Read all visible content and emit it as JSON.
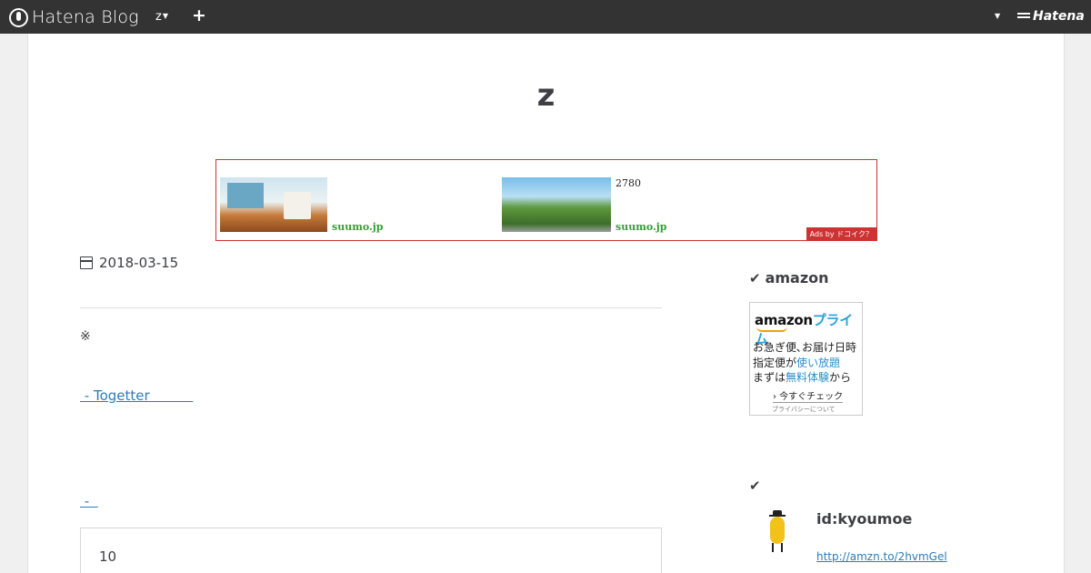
{
  "global_header": {
    "logo_text": "Hatena Blog",
    "blog_menu_label": "z",
    "add_label": "+",
    "brand_text": "Hatena"
  },
  "blog": {
    "title": "z"
  },
  "ad": {
    "item1_source": "suumo.jp",
    "item2_text": "2780",
    "item2_source": "suumo.jp",
    "badge": "Ads by ドコイク？"
  },
  "entry": {
    "date": "2018-03-15",
    "mark": "※",
    "link1": " - Togetter          ",
    "link2": " -  ",
    "quote_text": "10"
  },
  "sidebar": {
    "module1_title": "amazon",
    "amazon_ad": {
      "logo": "amazon",
      "prime": "プライム",
      "line1": "お急ぎ便､お届け日時",
      "line2_a": "指定便が",
      "line2_b": "使い放題",
      "line3_a": "まずは",
      "line3_b": "無料体験",
      "line3_c": "から",
      "cta": "› 今すぐチェック",
      "privacy": "プライバシーについて"
    },
    "module2_title": "",
    "profile": {
      "id": "id:kyoumoe",
      "link": "http://amzn.to/2hvmGel"
    }
  }
}
